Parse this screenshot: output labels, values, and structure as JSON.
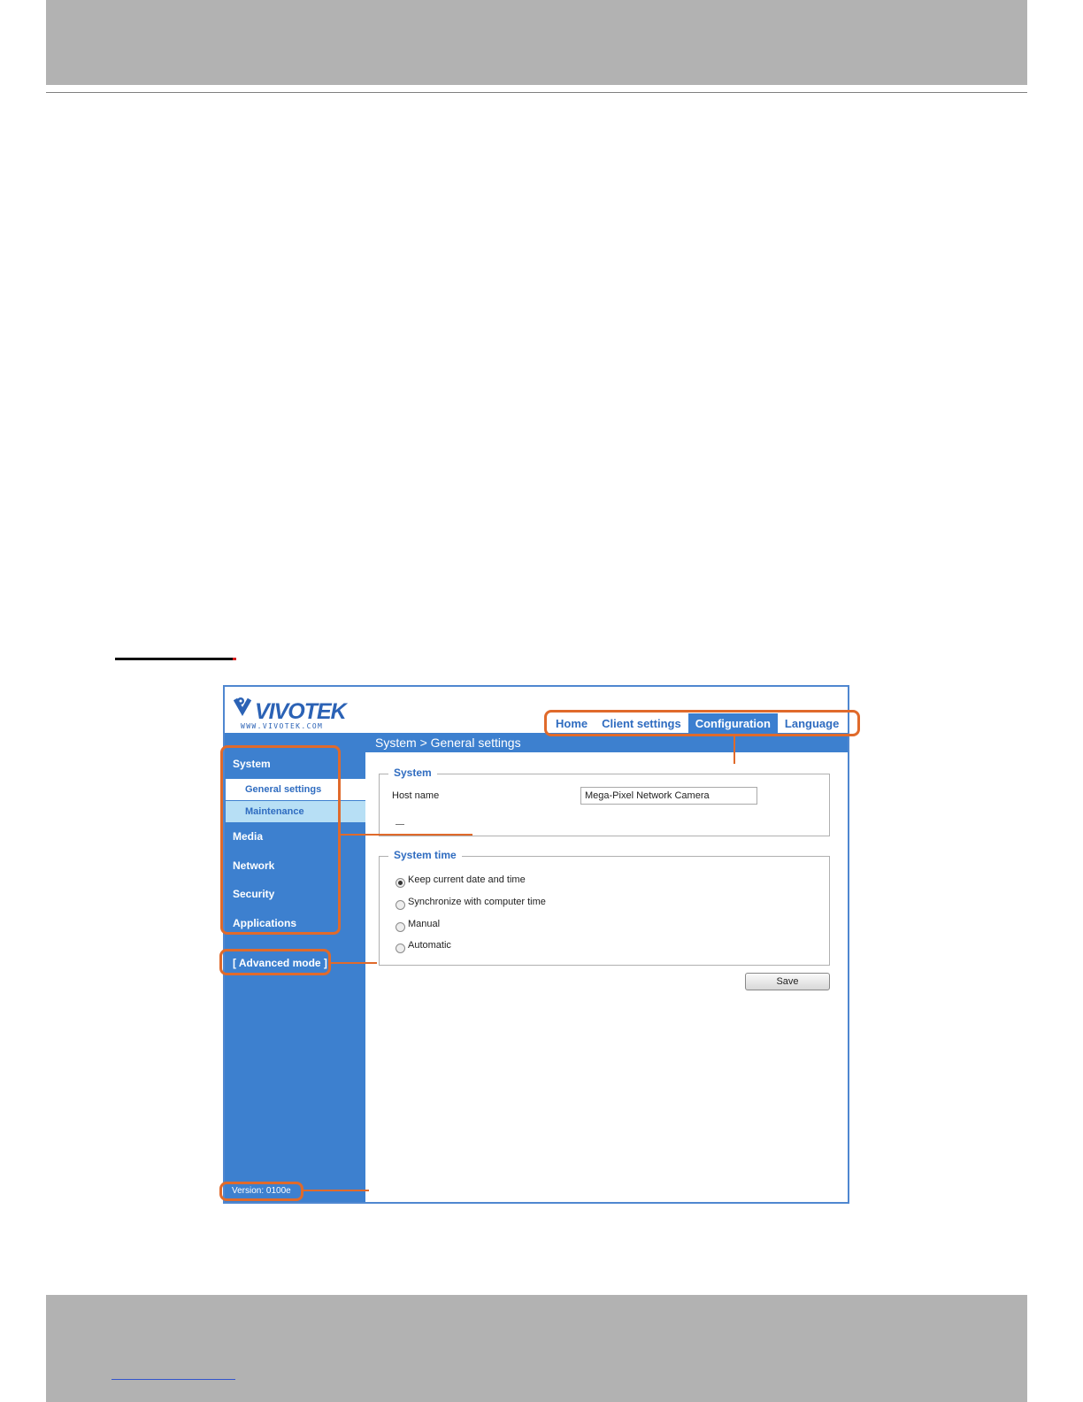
{
  "page": {
    "colors": {
      "band": "#b2b2b2",
      "accent": "#e06a2b",
      "ui_blue": "#3d80cf"
    }
  },
  "screenshot": {
    "logo": {
      "word": "VIVOTEK",
      "url": "WWW.VIVOTEK.COM"
    },
    "nav": [
      "Home",
      "Client settings",
      "Configuration",
      "Language"
    ],
    "nav_active": "Configuration",
    "breadcrumb": "System > General settings",
    "sidebar": {
      "system": "System",
      "sub_items": [
        "General settings",
        "Maintenance"
      ],
      "media": "Media",
      "network": "Network",
      "security": "Security",
      "applications": "Applications",
      "advanced": "[ Advanced mode ]",
      "version": "Version: 0100e"
    },
    "system_section": {
      "legend": "System",
      "host_label": "Host name",
      "host_value": "Mega-Pixel Network Camera"
    },
    "time_section": {
      "legend": "System time",
      "options": [
        "Keep current date and time",
        "Synchronize with computer time",
        "Manual",
        "Automatic"
      ],
      "selected": "Keep current date and time"
    },
    "save_label": "Save"
  }
}
